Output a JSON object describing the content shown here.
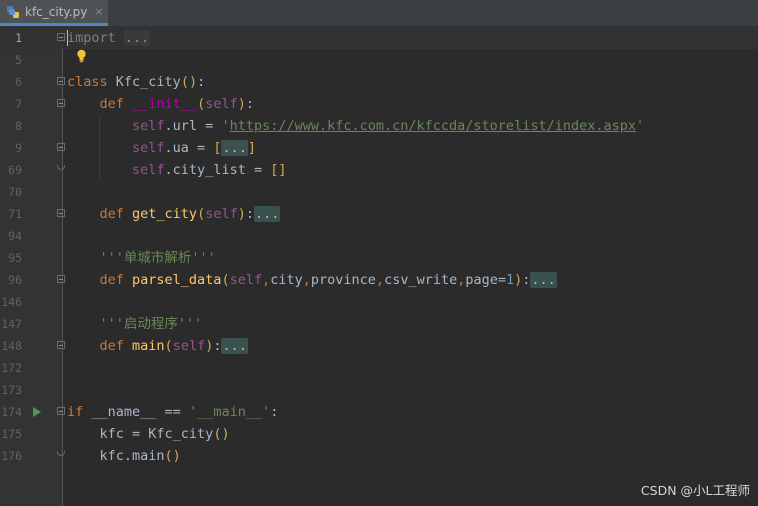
{
  "tab": {
    "filename": "kfc_city.py",
    "close": "×"
  },
  "lines": [
    {
      "n": "1",
      "fold": "open",
      "text": [
        [
          "imp",
          "import "
        ],
        [
          "dots-gray",
          "..."
        ]
      ]
    },
    {
      "n": "5",
      "text": []
    },
    {
      "n": "6",
      "fold": "open",
      "text": [
        [
          "kw",
          "class "
        ],
        [
          "plain",
          "Kfc_city"
        ],
        [
          "paren",
          "("
        ],
        [
          "paren",
          ")"
        ],
        [
          "plain",
          ":"
        ]
      ]
    },
    {
      "n": "7",
      "fold": "open",
      "text": [
        [
          "sp",
          "    "
        ],
        [
          "kw",
          "def "
        ],
        [
          "magic",
          "__init__"
        ],
        [
          "paren",
          "("
        ],
        [
          "self",
          "self"
        ],
        [
          "paren",
          ")"
        ],
        [
          "plain",
          ":"
        ]
      ]
    },
    {
      "n": "8",
      "text": [
        [
          "sp",
          "        "
        ],
        [
          "self",
          "self"
        ],
        [
          "plain",
          ".url = "
        ],
        [
          "str",
          "'"
        ],
        [
          "url",
          "https://www.kfc.com.cn/kfccda/storelist/index.aspx"
        ],
        [
          "str",
          "'"
        ]
      ]
    },
    {
      "n": "9",
      "fold": "open",
      "text": [
        [
          "sp",
          "        "
        ],
        [
          "self",
          "self"
        ],
        [
          "plain",
          ".ua = "
        ],
        [
          "paren",
          "["
        ],
        [
          "dots",
          "..."
        ],
        [
          "paren",
          "]"
        ]
      ]
    },
    {
      "n": "69",
      "fold": "end",
      "text": [
        [
          "sp",
          "        "
        ],
        [
          "self",
          "self"
        ],
        [
          "plain",
          ".city_list = "
        ],
        [
          "paren",
          "[]"
        ]
      ]
    },
    {
      "n": "70",
      "text": []
    },
    {
      "n": "71",
      "fold": "open",
      "text": [
        [
          "sp",
          "    "
        ],
        [
          "kw",
          "def "
        ],
        [
          "fn",
          "get_city"
        ],
        [
          "paren",
          "("
        ],
        [
          "self",
          "self"
        ],
        [
          "paren",
          ")"
        ],
        [
          "plain",
          ":"
        ],
        [
          "dots",
          "..."
        ]
      ]
    },
    {
      "n": "94",
      "text": []
    },
    {
      "n": "95",
      "text": [
        [
          "sp",
          "    "
        ],
        [
          "str",
          "'''单城市解析'''"
        ]
      ]
    },
    {
      "n": "96",
      "fold": "open",
      "text": [
        [
          "sp",
          "    "
        ],
        [
          "kw",
          "def "
        ],
        [
          "fn",
          "parsel_data"
        ],
        [
          "paren",
          "("
        ],
        [
          "self",
          "self"
        ],
        [
          "kw",
          ","
        ],
        [
          "plain",
          "city"
        ],
        [
          "kw",
          ","
        ],
        [
          "plain",
          "province"
        ],
        [
          "kw",
          ","
        ],
        [
          "plain",
          "csv_write"
        ],
        [
          "kw",
          ","
        ],
        [
          "plain",
          "page="
        ],
        [
          "num",
          "1"
        ],
        [
          "paren",
          ")"
        ],
        [
          "plain",
          ":"
        ],
        [
          "dots",
          "..."
        ]
      ]
    },
    {
      "n": "146",
      "text": []
    },
    {
      "n": "147",
      "text": [
        [
          "sp",
          "    "
        ],
        [
          "str",
          "'''启动程序'''"
        ]
      ]
    },
    {
      "n": "148",
      "fold": "open",
      "text": [
        [
          "sp",
          "    "
        ],
        [
          "kw",
          "def "
        ],
        [
          "fn",
          "main"
        ],
        [
          "paren",
          "("
        ],
        [
          "self",
          "self"
        ],
        [
          "paren",
          ")"
        ],
        [
          "plain",
          ":"
        ],
        [
          "dots",
          "..."
        ]
      ]
    },
    {
      "n": "172",
      "text": []
    },
    {
      "n": "173",
      "text": []
    },
    {
      "n": "174",
      "fold": "open",
      "run": true,
      "text": [
        [
          "kw",
          "if "
        ],
        [
          "plain",
          "__name__ == "
        ],
        [
          "str",
          "'__main__'"
        ],
        [
          "plain",
          ":"
        ]
      ]
    },
    {
      "n": "175",
      "text": [
        [
          "sp",
          "    "
        ],
        [
          "plain",
          "kfc = Kfc_city"
        ],
        [
          "paren",
          "()"
        ]
      ]
    },
    {
      "n": "176",
      "fold": "end",
      "text": [
        [
          "sp",
          "    "
        ],
        [
          "plain",
          "kfc.main"
        ],
        [
          "paren",
          "()"
        ]
      ]
    }
  ],
  "watermark": "CSDN @小L工程师"
}
